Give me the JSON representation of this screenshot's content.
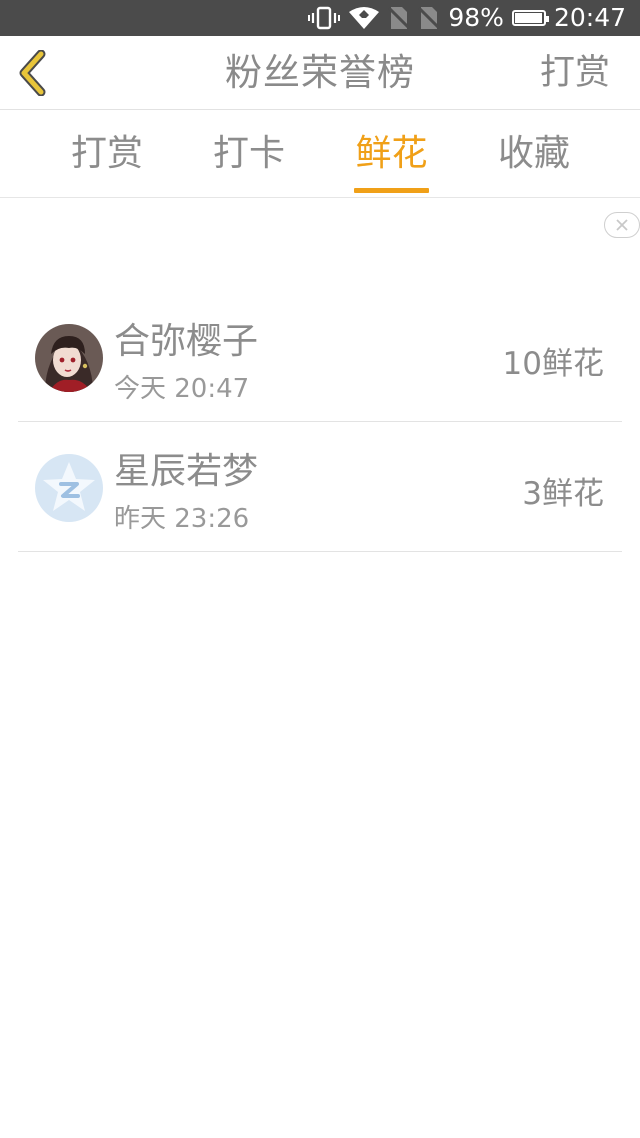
{
  "status_bar": {
    "battery": "98%",
    "time": "20:47",
    "battery_level": 0.98
  },
  "header": {
    "title": "粉丝荣誉榜",
    "action": "打赏"
  },
  "tabs": [
    {
      "label": "打赏",
      "active": false
    },
    {
      "label": "打卡",
      "active": false
    },
    {
      "label": "鲜花",
      "active": true
    },
    {
      "label": "收藏",
      "active": false
    }
  ],
  "colors": {
    "accent": "#f0a018",
    "text_muted": "#8c8c8c",
    "status_bar_bg": "#4b4b4b",
    "back_arrow": "#e8c53a"
  },
  "fans": [
    {
      "name": "合弥樱子",
      "time": "今天 20:47",
      "count": "10鲜花",
      "avatar": "anime-girl-avatar-icon"
    },
    {
      "name": "星辰若梦",
      "time": "昨天 23:26",
      "count": "3鲜花",
      "avatar": "qq-star-avatar-icon"
    }
  ]
}
